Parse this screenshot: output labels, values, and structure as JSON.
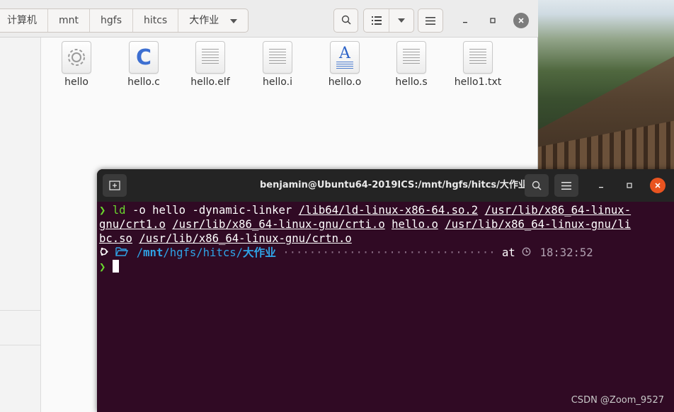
{
  "file_manager": {
    "breadcrumbs": [
      "计算机",
      "mnt",
      "hgfs",
      "hitcs",
      "大作业"
    ],
    "files": [
      {
        "name": "hello",
        "icon": "executable-gear-icon"
      },
      {
        "name": "hello.c",
        "icon": "c-source-icon"
      },
      {
        "name": "hello.elf",
        "icon": "text-file-icon"
      },
      {
        "name": "hello.i",
        "icon": "text-file-icon"
      },
      {
        "name": "hello.o",
        "icon": "font-document-icon"
      },
      {
        "name": "hello.s",
        "icon": "text-file-icon"
      },
      {
        "name": "hello1.txt",
        "icon": "text-file-icon"
      }
    ]
  },
  "terminal": {
    "title": "benjamin@Ubuntu64-2019ICS:/mnt/hgfs/hitcs/大作业",
    "prompt_symbol": "❯",
    "command_line_1": {
      "cmd": "ld",
      "args": " -o hello -dynamic-linker ",
      "u1": "/lib64/ld-linux-x86-64.so.2",
      "u2a": "/usr/lib/x86_64-linux-"
    },
    "command_line_2": {
      "u2b": "gnu/crt1.o",
      "u3": "/usr/lib/x86_64-linux-gnu/crti.o",
      "u4": "hello.o",
      "u5a": "/usr/lib/x86_64-linux-gnu/li"
    },
    "command_line_3": {
      "u5b": "bc.so",
      "u6": "/usr/lib/x86_64-linux-gnu/crtn.o"
    },
    "status": {
      "dir_prefix": "/",
      "dir_root": "mnt",
      "dir_rest": "/hgfs/hitcs/",
      "dir_last": "大作业",
      "dots": "································",
      "at": "at",
      "time": "18:32:52"
    }
  },
  "watermark": "CSDN @Zoom_9527",
  "colors": {
    "terminal_bg": "#300a24",
    "prompt_green": "#6ad82e",
    "path_blue": "#2fa3e6",
    "close_orange": "#e95420"
  }
}
